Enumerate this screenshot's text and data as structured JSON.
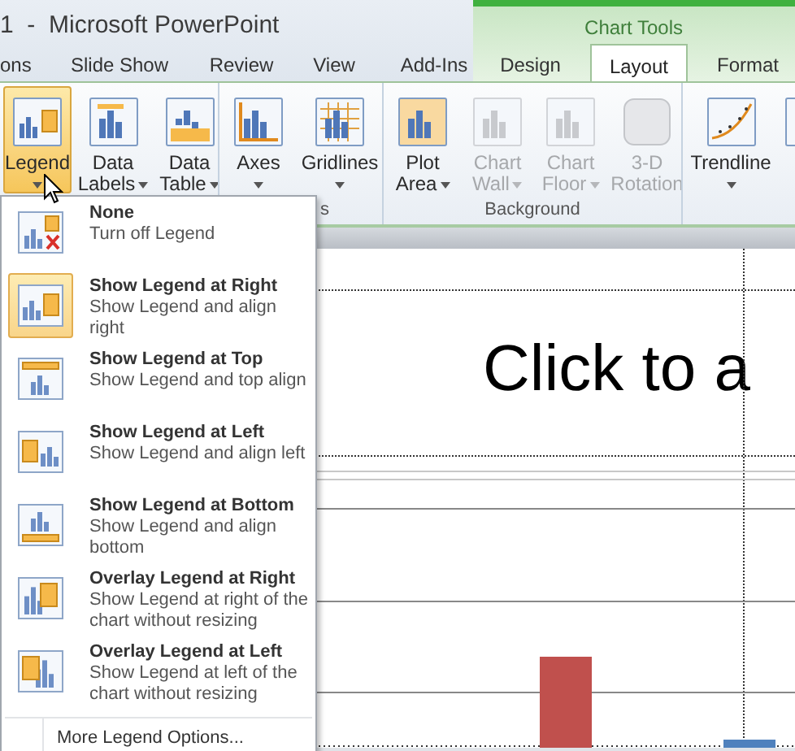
{
  "window": {
    "title": "1  -  Microsoft PowerPoint"
  },
  "tabs": [
    {
      "label": "ons",
      "selected": false
    },
    {
      "label": "Slide Show",
      "selected": false
    },
    {
      "label": "Review",
      "selected": false
    },
    {
      "label": "View",
      "selected": false
    },
    {
      "label": "Add-Ins",
      "selected": false
    }
  ],
  "chart_tools": {
    "title": "Chart Tools",
    "tabs": [
      {
        "label": "Design",
        "selected": false
      },
      {
        "label": "Layout",
        "selected": true
      },
      {
        "label": "Format",
        "selected": false
      }
    ]
  },
  "ribbon": {
    "groups": [
      {
        "buttons": [
          {
            "kind": "legend",
            "lines": [
              "Legend"
            ],
            "dropdown": true,
            "pressed": true,
            "disabled": false
          },
          {
            "kind": "data_labels",
            "lines": [
              "Data",
              "Labels"
            ],
            "dropdown": true,
            "pressed": false,
            "disabled": false
          },
          {
            "kind": "data_table",
            "lines": [
              "Data",
              "Table"
            ],
            "dropdown": true,
            "pressed": false,
            "disabled": false
          }
        ]
      },
      {
        "label": "s",
        "buttons": [
          {
            "kind": "axes",
            "lines": [
              "Axes"
            ],
            "dropdown": true,
            "pressed": false,
            "disabled": false
          },
          {
            "kind": "gridlines",
            "lines": [
              "Gridlines"
            ],
            "dropdown": true,
            "pressed": false,
            "disabled": false
          }
        ]
      },
      {
        "label": "Background",
        "buttons": [
          {
            "kind": "plot_area",
            "lines": [
              "Plot",
              "Area"
            ],
            "dropdown": true,
            "pressed": false,
            "disabled": false
          },
          {
            "kind": "chart_wall",
            "lines": [
              "Chart",
              "Wall"
            ],
            "dropdown": true,
            "pressed": false,
            "disabled": true
          },
          {
            "kind": "chart_floor",
            "lines": [
              "Chart",
              "Floor"
            ],
            "dropdown": true,
            "pressed": false,
            "disabled": true
          },
          {
            "kind": "rotation",
            "lines": [
              "3-D",
              "Rotation"
            ],
            "dropdown": false,
            "pressed": false,
            "disabled": true
          }
        ]
      },
      {
        "buttons": [
          {
            "kind": "trendline",
            "lines": [
              "Trendline"
            ],
            "dropdown": true,
            "pressed": false,
            "disabled": false
          },
          {
            "kind": "cut",
            "dropdown": false,
            "pressed": false,
            "disabled": false
          }
        ]
      }
    ]
  },
  "legend_menu": {
    "items": [
      {
        "kind": "none",
        "title": "None",
        "description": "Turn off Legend",
        "selected": false
      },
      {
        "kind": "right",
        "title": "Show Legend at Right",
        "description": "Show Legend and align right",
        "selected": true
      },
      {
        "kind": "top",
        "title": "Show Legend at Top",
        "description": "Show Legend and top align",
        "selected": false
      },
      {
        "kind": "left",
        "title": "Show Legend at Left",
        "description": "Show Legend and align left",
        "selected": false
      },
      {
        "kind": "bottom",
        "title": "Show Legend at Bottom",
        "description": "Show Legend and align bottom",
        "selected": false
      },
      {
        "kind": "overlay_right",
        "title": "Overlay Legend at Right",
        "description": "Show Legend at right of the chart without resizing",
        "selected": false
      },
      {
        "kind": "overlay_left",
        "title": "Overlay Legend at Left",
        "description": "Show Legend at left of the chart without resizing",
        "selected": false
      }
    ],
    "footer": "More Legend Options..."
  },
  "slide": {
    "title_placeholder": "Click to a"
  }
}
